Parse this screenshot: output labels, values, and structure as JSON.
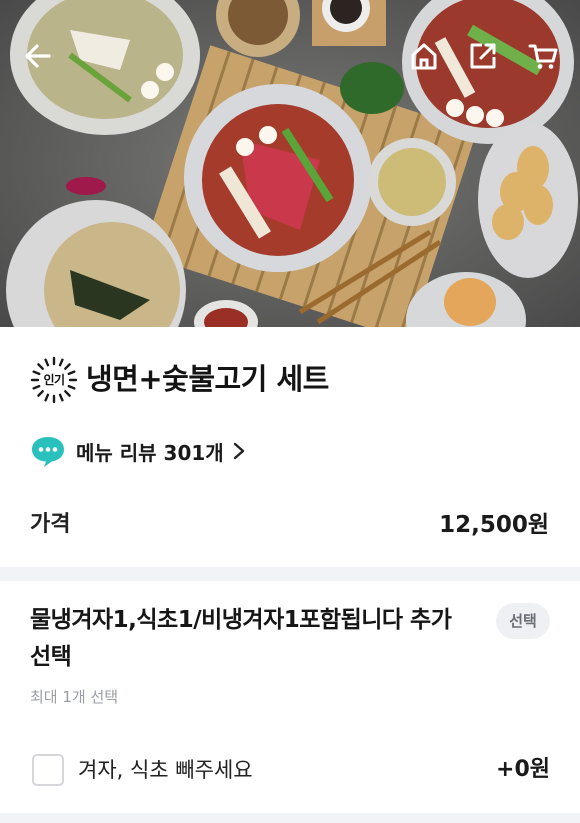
{
  "header": {
    "back_icon": "arrow-left-icon",
    "home_icon": "home-icon",
    "share_icon": "share-icon",
    "cart_icon": "cart-icon"
  },
  "menu": {
    "badge": "인기",
    "title": "냉면+숯불고기 세트",
    "review_label": "메뉴 리뷰 301개",
    "price_label": "가격",
    "price": "12,500원"
  },
  "option_group": {
    "title": "물냉겨자1,식초1/비냉겨자1포함됩니다 추가선택",
    "badge": "선택",
    "subtitle": "최대 1개 선택",
    "options": [
      {
        "label": "겨자, 식초 빼주세요",
        "price": "+0원",
        "checked": false
      }
    ]
  },
  "colors": {
    "accent_review": "#2ac1bc",
    "divider": "#f2f3f6",
    "badge_bg": "#eef0f4"
  }
}
